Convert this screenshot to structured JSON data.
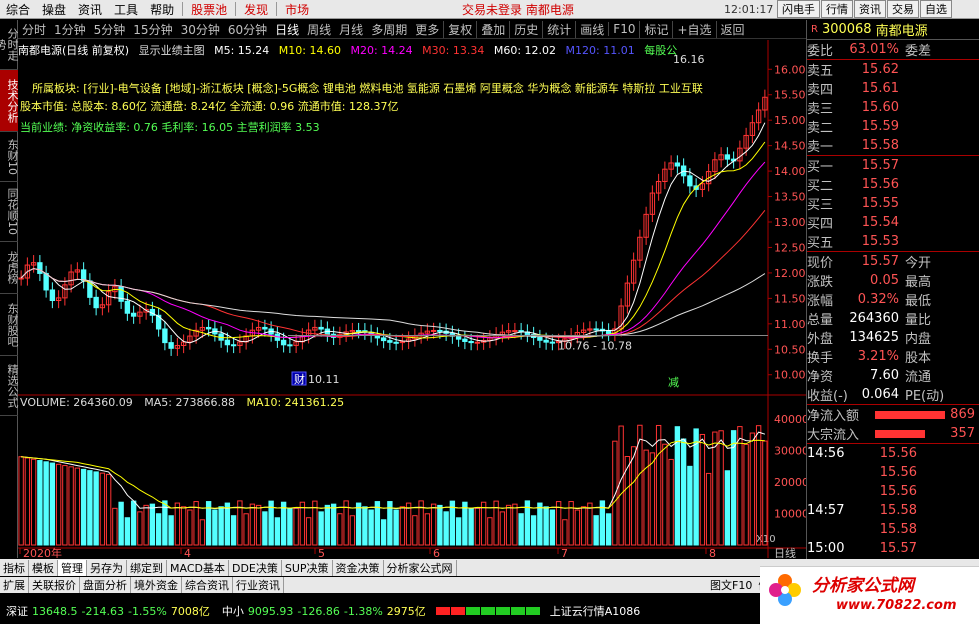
{
  "menu": {
    "items": [
      "综合",
      "操盘",
      "资讯",
      "工具",
      "帮助"
    ],
    "red_items": [
      "股票池",
      "发现"
    ],
    "market": "市场",
    "center": "交易未登录  南都电源",
    "clock": "12:01:17 周日",
    "right": [
      "闪电手",
      "行情",
      "资讯",
      "交易",
      "自选"
    ]
  },
  "toolbar": {
    "timeframes": [
      "分时",
      "1分钟",
      "5分钟",
      "15分钟",
      "30分钟",
      "60分钟",
      "日线",
      "周线",
      "月线",
      "多周期",
      "更多"
    ],
    "active": "日线",
    "tools": [
      "复权",
      "叠加",
      "历史",
      "统计",
      "画线",
      "F10",
      "标记",
      "+自选",
      "返回"
    ]
  },
  "left_tabs": [
    "分时走势",
    "技术分析",
    "东财10",
    "同花顺10",
    "龙虎榜",
    "东财股吧",
    "精选公式"
  ],
  "chart": {
    "title": "南都电源(日线 前复权)",
    "show": "显示业绩主图",
    "ma": [
      {
        "label": "M5: 15.24",
        "color": "#ffffff"
      },
      {
        "label": "M10: 14.60",
        "color": "#ffff00"
      },
      {
        "label": "M20: 14.24",
        "color": "#ff00ff"
      },
      {
        "label": "M30: 13.34",
        "color": "#ff3333"
      },
      {
        "label": "M60: 12.02",
        "color": "#ffffff"
      },
      {
        "label": "M120: 11.01",
        "color": "#5555ff"
      }
    ],
    "right_label": "每股公",
    "sector": "所属板块: [行业]-电气设备 [地域]-浙江板块 [概念]-5G概念 锂电池 燃料电池 氢能源 石墨烯 阿里概念 华为概念 新能源车 特斯拉 工业互联",
    "capital": "股本市值: 总股本: 8.60亿 流通盘: 8.24亿 全流通: 0.96 流通市值: 128.37亿",
    "performance": "当前业绩: 净资收益率: 0.76 毛利率: 16.05 主营利润率 3.53",
    "high_label": "16.16",
    "low_label": "10.11",
    "range_label": "10.76 - 10.78",
    "marker_cai": "财",
    "marker_jian": "减",
    "price_axis": [
      "16.00",
      "15.50",
      "15.00",
      "14.50",
      "14.00",
      "13.50",
      "13.00",
      "12.50",
      "12.00",
      "11.50",
      "11.00",
      "10.50",
      "10.00"
    ],
    "volume": {
      "label": "VOLUME: 264360.09",
      "ma5": "MA5: 273866.88",
      "ma10": "MA10: 241361.25",
      "axis": [
        "40000",
        "30000",
        "20000",
        "10000"
      ],
      "unit": "X10"
    },
    "dates": [
      "2020年",
      "4",
      "5",
      "6",
      "7",
      "8"
    ]
  },
  "chart_data": {
    "type": "bar",
    "title": "南都电源(日线 前复权)",
    "note": "candlestick",
    "last": 15.57,
    "high": 16.16,
    "low": 10.11
  },
  "bottom_tabs": [
    "指标",
    "模板",
    "管理",
    "另存为",
    "绑定到",
    "MACD基本",
    "DDE决策",
    "SUP决策",
    "资金决策",
    "分析家公式网"
  ],
  "active_bottom": "管理",
  "bottom2": [
    "扩展",
    "关联报价",
    "盘面分析",
    "境外资金",
    "综合资讯",
    "行业资讯"
  ],
  "bottom_right": [
    "图文F10",
    "侧边"
  ],
  "bottom_day": "日线",
  "quote": {
    "code": "300068",
    "name": "南都电源",
    "weibi_label": "委比",
    "weibi": "63.01%",
    "weicha": "委差",
    "sells": [
      {
        "l": "卖五",
        "v": "15.62"
      },
      {
        "l": "卖四",
        "v": "15.61"
      },
      {
        "l": "卖三",
        "v": "15.60"
      },
      {
        "l": "卖二",
        "v": "15.59"
      },
      {
        "l": "卖一",
        "v": "15.58"
      }
    ],
    "buys": [
      {
        "l": "买一",
        "v": "15.57"
      },
      {
        "l": "买二",
        "v": "15.56"
      },
      {
        "l": "买三",
        "v": "15.55"
      },
      {
        "l": "买四",
        "v": "15.54"
      },
      {
        "l": "买五",
        "v": "15.53"
      }
    ],
    "stats": [
      {
        "l": "现价",
        "v": "15.57",
        "l2": "今开"
      },
      {
        "l": "涨跌",
        "v": "0.05",
        "l2": "最高"
      },
      {
        "l": "涨幅",
        "v": "0.32%",
        "l2": "最低"
      },
      {
        "l": "总量",
        "v": "264360",
        "l2": "量比"
      },
      {
        "l": "外盘",
        "v": "134625",
        "l2": "内盘"
      },
      {
        "l": "换手",
        "v": "3.21%",
        "l2": "股本"
      },
      {
        "l": "净资",
        "v": "7.60",
        "l2": "流通"
      },
      {
        "l": "收益(-)",
        "v": "0.064",
        "l2": "PE(动)"
      }
    ],
    "flows": [
      {
        "l": "净流入额",
        "v": "869",
        "w": 70
      },
      {
        "l": "大宗流入",
        "v": "357",
        "w": 50
      }
    ],
    "ticks": [
      {
        "t": "14:56",
        "vals": [
          "15.56",
          "15.56",
          "15.56"
        ]
      },
      {
        "t": "14:57",
        "vals": [
          "15.58",
          "15.58"
        ]
      },
      {
        "t": "15:00",
        "vals": [
          "15.57"
        ]
      }
    ]
  },
  "status": {
    "sz": "深证",
    "sz_val": "13648.5",
    "sz_chg": "-214.63",
    "sz_pct": "-1.55%",
    "sz_amt": "7008亿",
    "zx": "中小",
    "zx_val": "9095.93",
    "zx_chg": "-126.86",
    "zx_pct": "-1.38%",
    "zx_amt": "2975亿",
    "cloud": "上证云行情A1086"
  },
  "watermark": {
    "text": "分析家公式网",
    "url": "www.70822.com"
  }
}
